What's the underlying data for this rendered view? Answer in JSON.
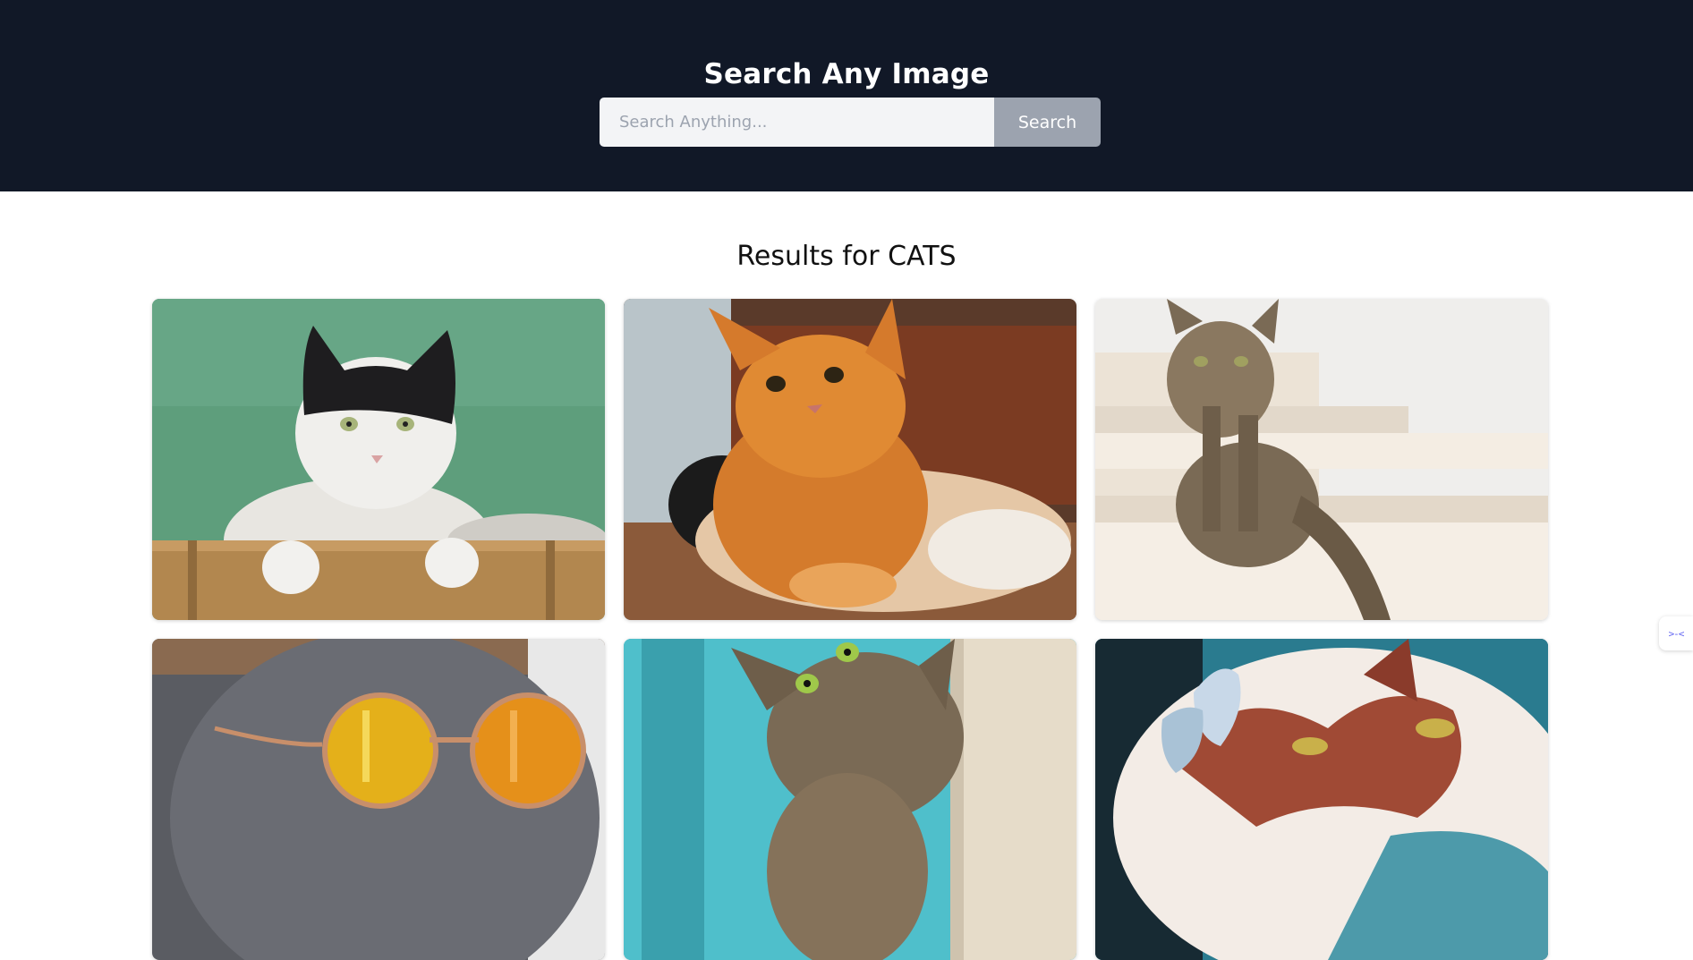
{
  "header": {
    "title": "Search Any Image",
    "bg_color": "#111827"
  },
  "search": {
    "placeholder": "Search Anything...",
    "value": "",
    "button_label": "Search"
  },
  "results": {
    "title": "Results for CATS",
    "images": [
      {
        "subject": "black and white cat on green background"
      },
      {
        "subject": "orange tabby cat lying down"
      },
      {
        "subject": "tabby cat sitting on stairs"
      },
      {
        "subject": "grey cat wearing round sunglasses"
      },
      {
        "subject": "tabby cat peeking by blue fence"
      },
      {
        "subject": "fluffy cat with butterfly on nose"
      }
    ]
  },
  "side_widget": {
    "icon": "collapse-icon"
  }
}
